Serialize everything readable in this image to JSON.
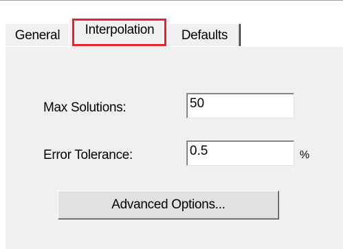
{
  "tabs": [
    {
      "label": "General",
      "selected": false
    },
    {
      "label": "Interpolation",
      "selected": true
    },
    {
      "label": "Defaults",
      "selected": false
    }
  ],
  "highlight_color": "#e8232f",
  "fields": {
    "max_solutions": {
      "label": "Max Solutions:",
      "value": "50"
    },
    "error_tolerance": {
      "label": "Error Tolerance:",
      "value": "0.5",
      "unit": "%"
    }
  },
  "advanced_button_label": "Advanced Options..."
}
